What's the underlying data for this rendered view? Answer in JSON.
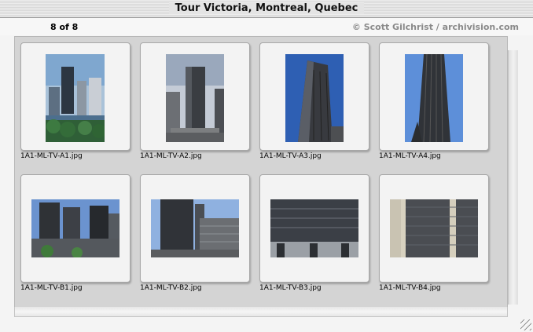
{
  "window": {
    "title": "Tour Victoria, Montreal, Quebec"
  },
  "info": {
    "count": "8 of 8",
    "credit": "© Scott Gilchrist / archivision.com"
  },
  "thumbnails": [
    {
      "filename": "1A1-ML-TV-A1.jpg"
    },
    {
      "filename": "1A1-ML-TV-A2.jpg"
    },
    {
      "filename": "1A1-ML-TV-A3.jpg"
    },
    {
      "filename": "1A1-ML-TV-A4.jpg"
    },
    {
      "filename": "1A1-ML-TV-B1.jpg"
    },
    {
      "filename": "1A1-ML-TV-B2.jpg"
    },
    {
      "filename": "1A1-ML-TV-B3.jpg"
    },
    {
      "filename": "1A1-ML-TV-B4.jpg"
    }
  ]
}
